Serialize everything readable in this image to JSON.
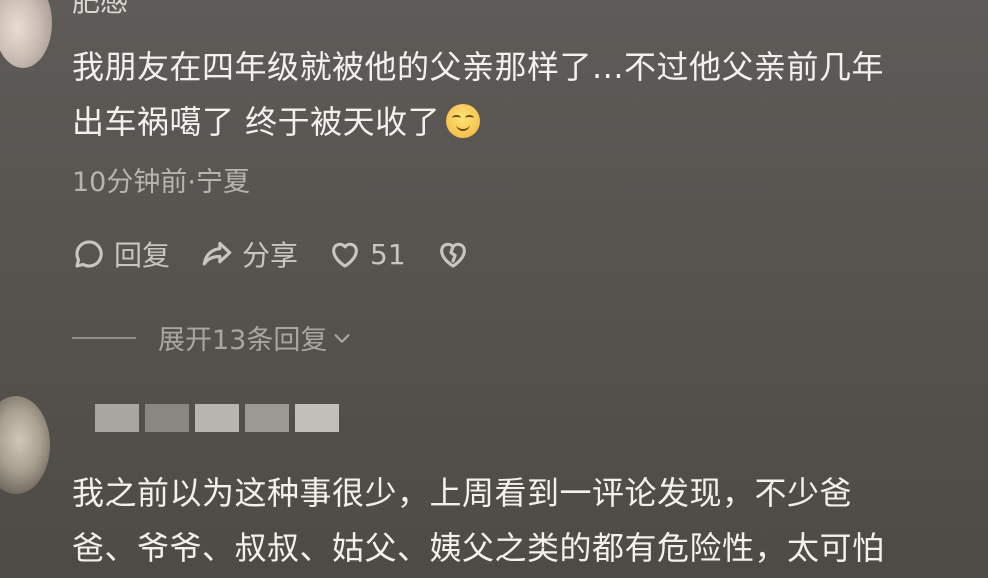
{
  "comment1": {
    "username": "肥感",
    "text_line1": "我朋友在四年级就被他的父亲那样了...不过他父亲前几年",
    "text_line2": "出车祸噶了 终于被天收了",
    "emoji": "smiling-face-emoji",
    "meta": "10分钟前·宁夏",
    "reply_label": "回复",
    "share_label": "分享",
    "like_count": "51",
    "expand_label": "展开13条回复"
  },
  "comment2": {
    "username_blurred": true,
    "text_line1": "我之前以为这种事很少，上周看到一评论发现，不少爸",
    "text_line2": "爸、爷爷、叔叔、姑父、姨父之类的都有危险性，太可怕"
  },
  "colors": {
    "background": "#57534f",
    "text_primary": "#f2f1ee",
    "text_secondary": "#b7b3ae"
  }
}
